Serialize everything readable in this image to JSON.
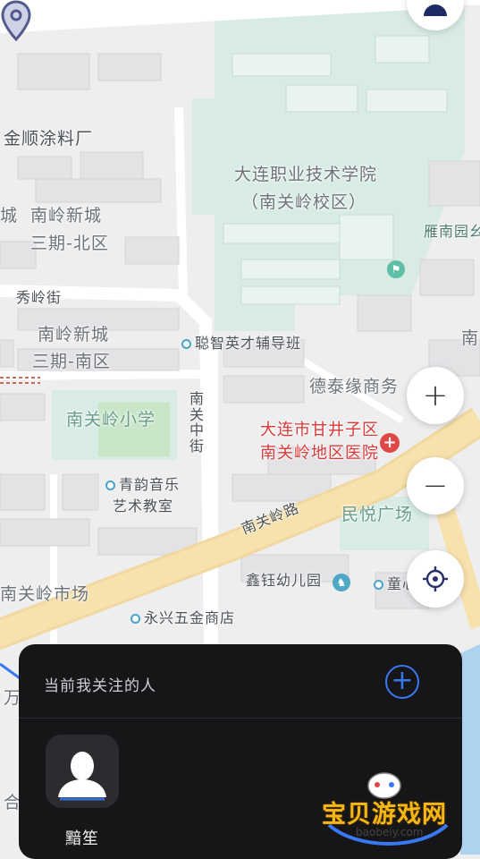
{
  "map": {
    "labels": {
      "jinshun": "金顺涂料厂",
      "college_1": "大连职业技术学院",
      "college_2": "（南关岭校区）",
      "cheng": "城",
      "nanling3_1": "南岭新城",
      "nanling3_2": "三期-北区",
      "yannan": "雁南园幺",
      "xiuling": "秀岭街",
      "nanling_s1": "南岭新城",
      "nanling_s2": "三期-南区",
      "congzhi": "聪智英才辅导班",
      "nan_edge": "南",
      "detai": "德泰缘商务",
      "nanguan_school": "南关岭小学",
      "zhongjie": "南关中街",
      "hospital_1": "大连市甘井子区",
      "hospital_2": "南关岭地区医院",
      "qingyun_1": "青韵音乐",
      "qingyun_2": "艺术教室",
      "minyue": "民悦广场",
      "road": "南关岭路",
      "xinyu": "鑫钰幼儿园",
      "tongxin": "童心",
      "market": "南关岭市场",
      "yongxing": "永兴五金商店",
      "wan": "万",
      "he": "合"
    }
  },
  "controls": {
    "zoom_in": "+",
    "zoom_out": "−"
  },
  "panel": {
    "title": "当前我关注的人",
    "add_label": "+",
    "contact_name": "黯笙"
  },
  "watermark": {
    "text": "宝贝游戏网",
    "url": "baobeiy.com"
  },
  "colors": {
    "map_bg": "#eeeeef",
    "green_area": "#d8ece5",
    "road_yellow": "#f7dca0",
    "panel_bg": "#161618",
    "accent_blue": "#3a78f2",
    "pin": "#535a8c",
    "hospital_red": "#d93a3a"
  }
}
